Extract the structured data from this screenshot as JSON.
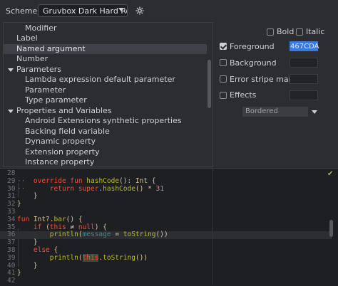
{
  "scheme": {
    "label": "Scheme:",
    "value": "Gruvbox Dark Hard Rom"
  },
  "tree": {
    "items": [
      {
        "label": "Modifier",
        "expanded": null
      },
      {
        "label": "Label",
        "expanded": null
      },
      {
        "label": "Named argument",
        "expanded": null,
        "selected": true
      },
      {
        "label": "Number",
        "expanded": null
      },
      {
        "label": "Parameters",
        "expanded": true
      },
      {
        "label": "Lambda expression default parameter",
        "expanded": null
      },
      {
        "label": "Parameter",
        "expanded": null
      },
      {
        "label": "Type parameter",
        "expanded": null
      },
      {
        "label": "Properties and Variables",
        "expanded": true
      },
      {
        "label": "Android Extensions synthetic properties",
        "expanded": null
      },
      {
        "label": "Backing field variable",
        "expanded": null
      },
      {
        "label": "Dynamic property",
        "expanded": null
      },
      {
        "label": "Extension property",
        "expanded": null
      },
      {
        "label": "Instance property",
        "expanded": null
      }
    ]
  },
  "options": {
    "bold": {
      "label": "Bold",
      "checked": false
    },
    "italic": {
      "label": "Italic",
      "checked": false
    },
    "foreground": {
      "label": "Foreground",
      "checked": true,
      "value": "467CDA",
      "color": "#467cda"
    },
    "background": {
      "label": "Background",
      "checked": false
    },
    "error_stripe": {
      "label": "Error stripe mark",
      "checked": false
    },
    "effects": {
      "label": "Effects",
      "checked": false,
      "type": "Bordered"
    }
  },
  "code": {
    "lines": [
      {
        "n": "28",
        "text": ""
      },
      {
        "n": "29",
        "text": "    override fun hashCode(): Int {"
      },
      {
        "n": "30",
        "text": "        return super.hashCode() * 31"
      },
      {
        "n": "31",
        "text": "    }"
      },
      {
        "n": "32",
        "text": "}"
      },
      {
        "n": "33",
        "text": ""
      },
      {
        "n": "34",
        "text": "fun Int?.bar() {"
      },
      {
        "n": "35",
        "text": "    if (this ≠ null) {"
      },
      {
        "n": "36",
        "text": "        println(message = toString())"
      },
      {
        "n": "37",
        "text": "    }"
      },
      {
        "n": "38",
        "text": "    else {"
      },
      {
        "n": "39",
        "text": "        println(this.toString())"
      },
      {
        "n": "40",
        "text": "    }"
      },
      {
        "n": "41",
        "text": "}"
      },
      {
        "n": "42",
        "text": ""
      }
    ]
  },
  "colors": {
    "accent": "#467cda",
    "keyword": "#fb4934",
    "function": "#b8bb26",
    "number": "#d3869b"
  }
}
